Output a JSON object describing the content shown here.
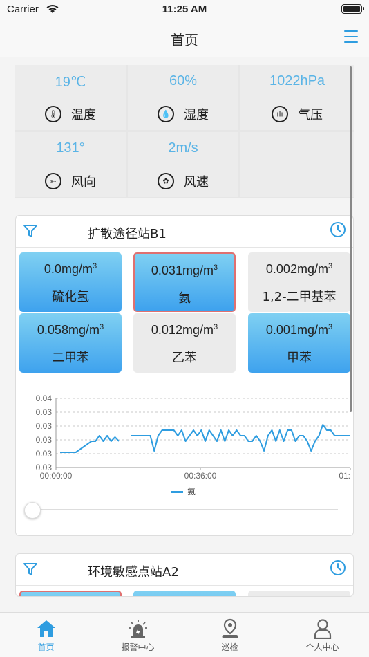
{
  "status_bar": {
    "carrier": "Carrier",
    "time": "11:25 AM"
  },
  "nav": {
    "title": "首页",
    "menu_icon": "hamburger-menu-icon"
  },
  "weather": [
    {
      "value": "19℃",
      "label": "温度",
      "icon": "thermometer-icon"
    },
    {
      "value": "60%",
      "label": "湿度",
      "icon": "droplet-icon"
    },
    {
      "value": "1022hPa",
      "label": "气压",
      "icon": "pressure-icon"
    },
    {
      "value": "131°",
      "label": "风向",
      "icon": "wind-direction-icon"
    },
    {
      "value": "2m/s",
      "label": "风速",
      "icon": "wind-speed-icon"
    }
  ],
  "station1": {
    "name": "扩散途径站B1",
    "readings": [
      {
        "value": "0.0mg/m",
        "unit_sup": "3",
        "name": "硫化氢",
        "style": "blue"
      },
      {
        "value": "0.031mg/m",
        "unit_sup": "3",
        "name": "氨",
        "style": "blue-alarm"
      },
      {
        "value": "0.002mg/m",
        "unit_sup": "3",
        "name": "1,2-二甲基苯",
        "style": "gray"
      },
      {
        "value": "0.058mg/m",
        "unit_sup": "3",
        "name": "二甲苯",
        "style": "blue"
      },
      {
        "value": "0.012mg/m",
        "unit_sup": "3",
        "name": "乙苯",
        "style": "gray"
      },
      {
        "value": "0.001mg/m",
        "unit_sup": "3",
        "name": "甲苯",
        "style": "blue"
      }
    ]
  },
  "station2": {
    "name": "环境敏感点站A2"
  },
  "chart_data": {
    "type": "line",
    "yticks": [
      "0.04",
      "0.03",
      "0.03",
      "0.03",
      "0.03",
      "0.03"
    ],
    "xticks": [
      "00:00:00",
      "00:36:00",
      "01:"
    ],
    "ylim": [
      0.029,
      0.034
    ],
    "legend": "氨",
    "series": [
      {
        "name": "氨",
        "color": "#2f9de0",
        "x": [
          0,
          4,
          8,
          9,
          10,
          11,
          12,
          13,
          14,
          15,
          16,
          17,
          18,
          19,
          20,
          21,
          22,
          23,
          24,
          25,
          26,
          27,
          28,
          29,
          30,
          31,
          32,
          33,
          34,
          35,
          36,
          37,
          38,
          39,
          40,
          41,
          42,
          43,
          44,
          45,
          46,
          47,
          48,
          49,
          50,
          51,
          52,
          53,
          54,
          55,
          56,
          57,
          58,
          59,
          60,
          61,
          62,
          63,
          64,
          65,
          66,
          67,
          68,
          69,
          70,
          71,
          72,
          73,
          74
        ],
        "values": [
          0.0301,
          0.0301,
          0.0309,
          0.0309,
          0.0313,
          0.0309,
          0.0313,
          0.0309,
          0.0312,
          0.0309,
          null,
          null,
          0.0313,
          0.0313,
          0.0313,
          0.0313,
          0.0313,
          0.0313,
          0.0302,
          0.0313,
          0.0317,
          0.0317,
          0.0317,
          0.0317,
          0.0313,
          0.0317,
          0.0309,
          0.0313,
          0.0317,
          0.0313,
          0.0317,
          0.0309,
          0.0317,
          0.0313,
          0.0309,
          0.0317,
          0.0309,
          0.0317,
          0.0313,
          0.0317,
          0.0313,
          0.0313,
          0.0309,
          0.0309,
          0.0313,
          0.0309,
          0.0302,
          0.0313,
          0.0317,
          0.0309,
          0.0317,
          0.0309,
          0.0317,
          0.0317,
          0.0309,
          0.0313,
          0.0313,
          0.0309,
          0.0302,
          0.0309,
          0.0313,
          0.0321,
          0.0317,
          0.0317,
          0.0313,
          0.0313,
          0.0313,
          0.0313,
          0.0313
        ]
      }
    ]
  },
  "tabs": [
    {
      "label": "首页",
      "icon": "home-icon",
      "active": true
    },
    {
      "label": "报警中心",
      "icon": "alarm-light-icon",
      "active": false
    },
    {
      "label": "巡检",
      "icon": "location-pin-icon",
      "active": false
    },
    {
      "label": "个人中心",
      "icon": "person-icon",
      "active": false
    }
  ]
}
